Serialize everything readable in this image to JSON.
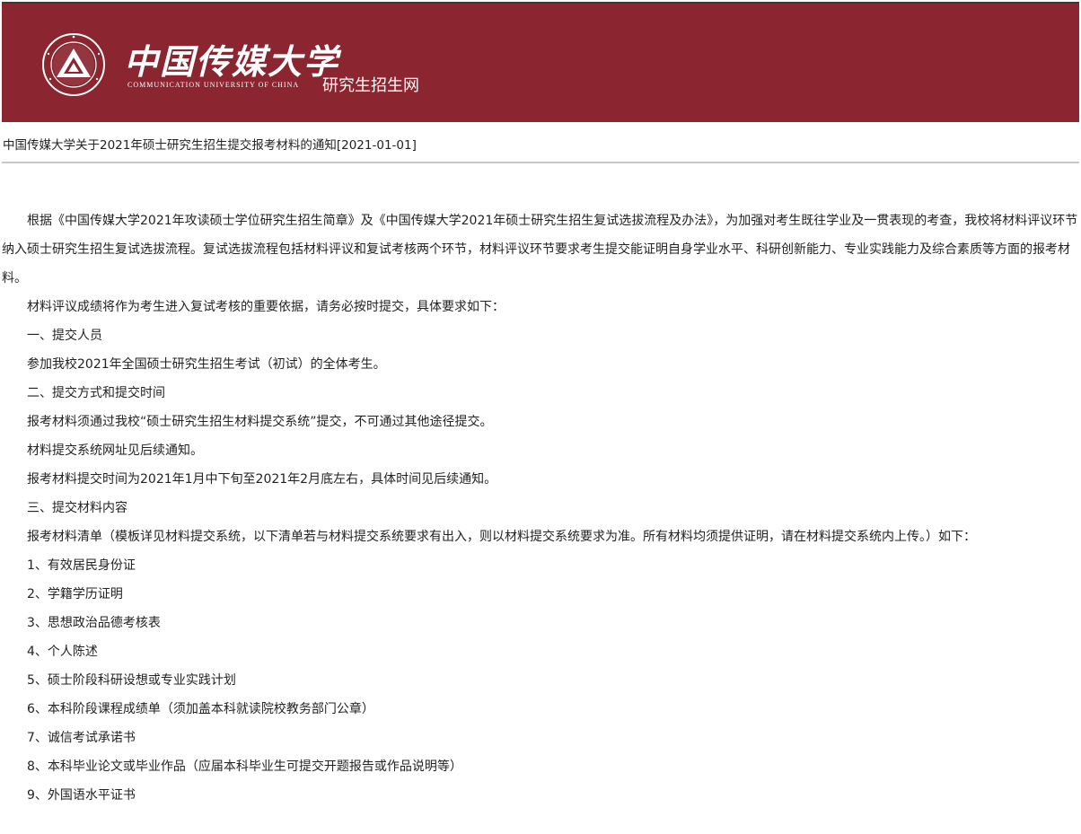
{
  "header": {
    "brand_cn": "中国传媒大学",
    "brand_en": "COMMUNICATION UNIVERSITY OF CHINA",
    "site_name": "研究生招生网",
    "seal_icon": "university-seal-icon",
    "background_color": "#8b2530"
  },
  "notice": {
    "title": "中国传媒大学关于2021年硕士研究生招生提交报考材料的通知[2021-01-01]"
  },
  "article": {
    "paragraphs": [
      "根据《中国传媒大学2021年攻读硕士学位研究生招生简章》及《中国传媒大学2021年硕士研究生招生复试选拔流程及办法》，为加强对考生既往学业及一贯表现的考查，我校将材料评议环节纳入硕士研究生招生复试选拔流程。复试选拔流程包括材料评议和复试考核两个环节，材料评议环节要求考生提交能证明自身学业水平、科研创新能力、专业实践能力及综合素质等方面的报考材料。",
      "材料评议成绩将作为考生进入复试考核的重要依据，请务必按时提交，具体要求如下：",
      "一、提交人员",
      "参加我校2021年全国硕士研究生招生考试（初试）的全体考生。",
      "二、提交方式和提交时间",
      "报考材料须通过我校“硕士研究生招生材料提交系统”提交，不可通过其他途径提交。",
      "材料提交系统网址见后续通知。",
      "报考材料提交时间为2021年1月中下旬至2021年2月底左右，具体时间见后续通知。",
      "三、提交材料内容",
      "报考材料清单（模板详见材料提交系统，以下清单若与材料提交系统要求有出入，则以材料提交系统要求为准。所有材料均须提供证明，请在材料提交系统内上传。）如下：",
      "1、有效居民身份证",
      "2、学籍学历证明",
      "3、思想政治品德考核表",
      "4、个人陈述",
      "5、硕士阶段科研设想或专业实践计划",
      "6、本科阶段课程成绩单（须加盖本科就读院校教务部门公章）",
      "7、诚信考试承诺书",
      "8、本科毕业论文或毕业作品（应届本科毕业生可提交开题报告或作品说明等）",
      "9、外国语水平证书"
    ]
  }
}
